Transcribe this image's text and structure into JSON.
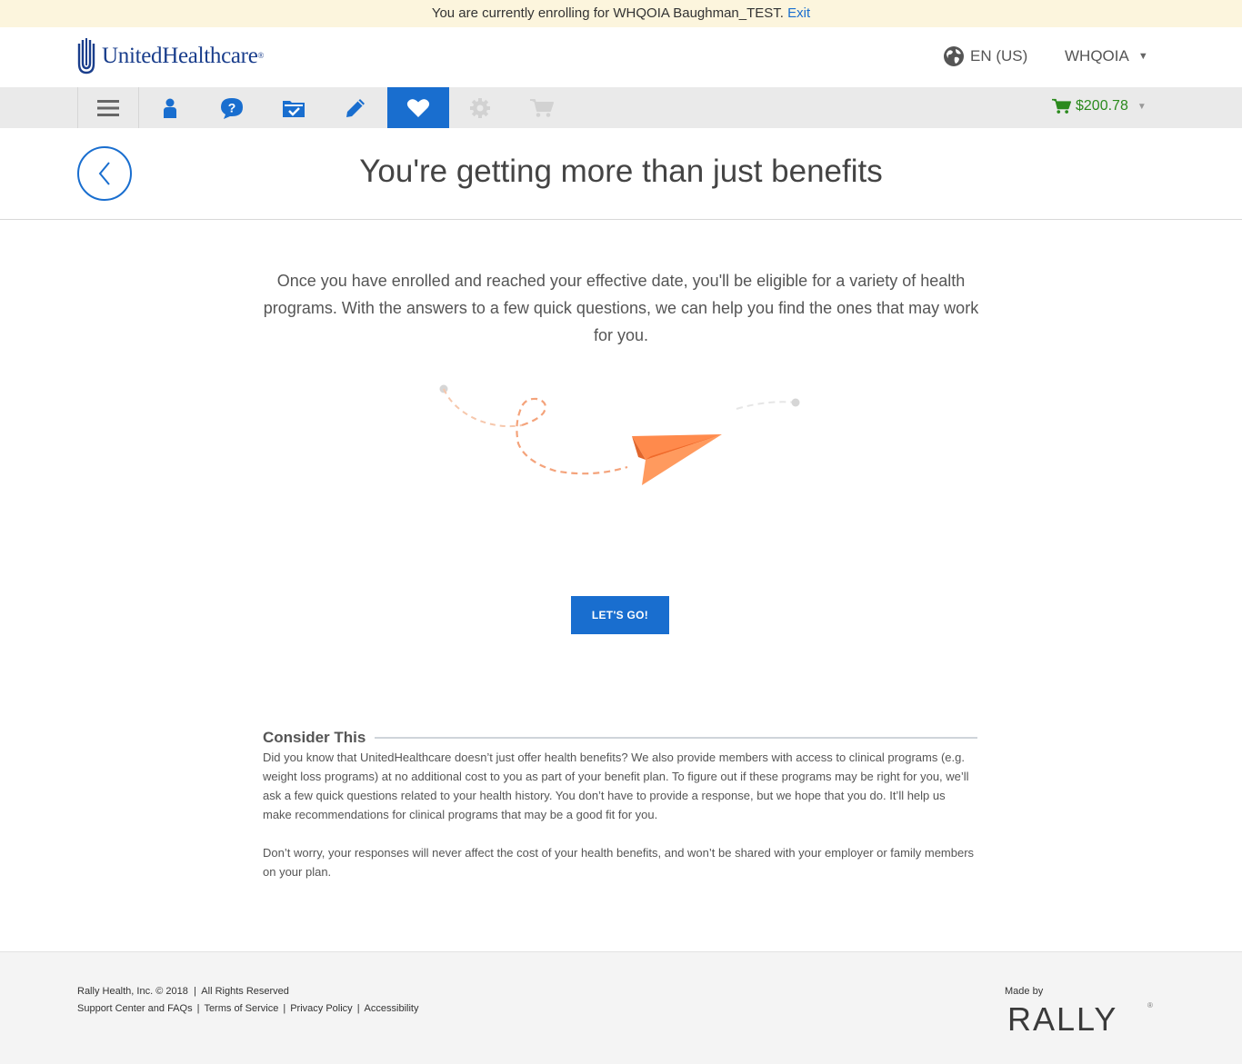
{
  "banner": {
    "text": "You are currently enrolling for WHQOIA Baughman_TEST.",
    "exit_link": "Exit"
  },
  "header": {
    "logo_text": "UnitedHealthcare",
    "logo_mark": "®",
    "language": "EN (US)",
    "account": "WHQOIA"
  },
  "nav": {
    "items": [
      {
        "icon": "hamburger-menu-icon"
      },
      {
        "icon": "person-icon"
      },
      {
        "icon": "question-icon"
      },
      {
        "icon": "folder-check-icon"
      },
      {
        "icon": "pencil-icon"
      },
      {
        "icon": "heart-icon",
        "active": true
      },
      {
        "icon": "gear-icon",
        "disabled": true
      },
      {
        "icon": "cart-icon",
        "disabled": true
      }
    ],
    "cart_total": "$200.78"
  },
  "colors": {
    "primary": "#196ecf",
    "cart_green": "#2b8a1d",
    "plane_orange": "#ff8a4c"
  },
  "page": {
    "title": "You're getting more than just benefits",
    "intro": "Once you have enrolled and reached your effective date, you'll be eligible for a variety of health programs. With the answers to a few quick questions, we can help you find the ones that may work for you.",
    "cta": "LET'S GO!"
  },
  "consider": {
    "title": "Consider This",
    "p1": "Did you know that UnitedHealthcare doesn’t just offer health benefits? We also provide members with access to clinical programs (e.g. weight loss programs) at no additional cost to you as part of your benefit plan. To figure out if these programs may be right for you, we’ll ask a few quick questions related to your health history. You don’t have to provide a response, but we hope that you do. It’ll help us make recommendations for clinical programs that may be a good fit for you.",
    "p2": "Don’t worry, your responses will never affect the cost of your health benefits, and won’t be shared with your employer or family members on your plan."
  },
  "footer": {
    "copyright": "Rally Health, Inc. © 2018  |  All Rights Reserved",
    "links": [
      "Support Center and FAQs",
      "Terms of Service",
      "Privacy Policy",
      "Accessibility"
    ],
    "made_by": "Made by",
    "brand": "RALLY"
  }
}
